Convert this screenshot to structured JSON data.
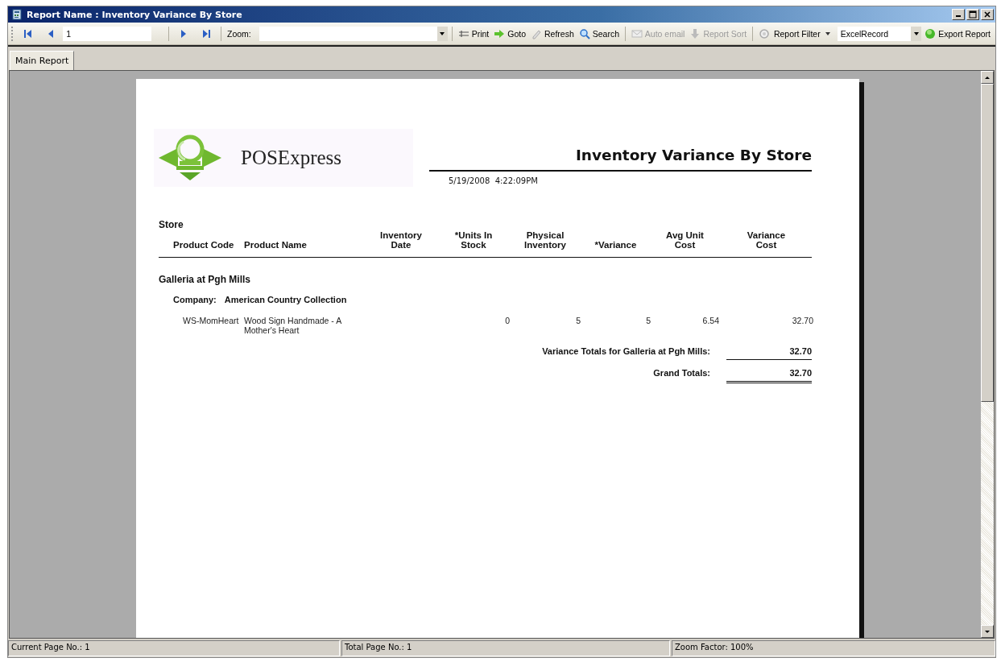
{
  "window": {
    "title": "Report Name : Inventory Variance By Store"
  },
  "toolbar": [
    {
      "kind": "nav"
    },
    {
      "kind": "nav"
    },
    {
      "kind": "field",
      "value": "1"
    },
    {
      "kind": "separator"
    },
    {
      "kind": "nav"
    },
    {
      "kind": "nav"
    },
    {
      "kind": "separator"
    },
    {
      "kind": "label",
      "label": "Zoom:"
    },
    {
      "kind": "combo"
    },
    {
      "kind": "separator"
    },
    {
      "kind": "button",
      "label": "Print",
      "disabled": false
    },
    {
      "kind": "button",
      "label": "Goto",
      "disabled": false
    },
    {
      "kind": "button",
      "label": "Refresh",
      "disabled": false
    },
    {
      "kind": "button",
      "label": "Search",
      "disabled": false
    },
    {
      "kind": "separator"
    },
    {
      "kind": "button",
      "label": "Auto email",
      "disabled": true
    },
    {
      "kind": "button",
      "label": "Report Sort",
      "disabled": true
    },
    {
      "kind": "separator"
    },
    {
      "kind": "button",
      "label": "Report Filter",
      "disabled": false
    },
    {
      "kind": "combo",
      "value": "ExcelRecord"
    },
    {
      "kind": "button",
      "label": "Export Report",
      "disabled": false
    }
  ],
  "tabs": [
    {
      "label": "Main Report",
      "selected": true
    }
  ],
  "report": {
    "logo_text": "POSExpress",
    "title": "Inventory Variance By Store",
    "timestamp": "5/19/2008  4:22:09PM",
    "group_heading": "Store",
    "columns": [
      {
        "lines": [
          "Product Code"
        ]
      },
      {
        "lines": [
          "Product Name"
        ]
      },
      {
        "lines": [
          "Inventory",
          "Date"
        ]
      },
      {
        "lines": [
          "*Units In",
          "Stock"
        ]
      },
      {
        "lines": [
          "Physical",
          "Inventory"
        ]
      },
      {
        "lines": [
          "*Variance"
        ]
      },
      {
        "lines": [
          "Avg Unit",
          "Cost"
        ]
      },
      {
        "lines": [
          "Variance",
          "Cost"
        ]
      }
    ],
    "store": "Galleria at Pgh Mills",
    "company_label": "Company:",
    "company": "American Country Collection",
    "rows": [
      [
        "WS-MomHeart",
        "Wood Sign Handmade - A Mother's Heart",
        null,
        "0",
        "5",
        "5",
        "6.54",
        "32.70"
      ]
    ],
    "subtotal": {
      "label": "Variance Totals for Galleria at Pgh Mills:",
      "value": "32.70"
    },
    "grand_total": {
      "label": "Grand Totals:",
      "value": "32.70"
    }
  },
  "status_bar": [
    "Current Page No.: 1",
    "Total Page No.: 1",
    "Zoom Factor: 100%"
  ]
}
